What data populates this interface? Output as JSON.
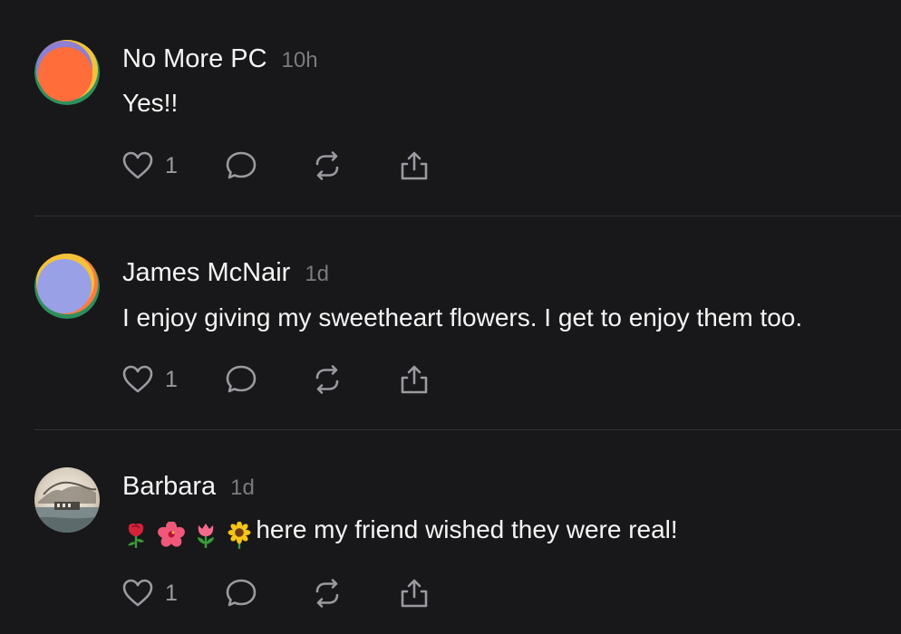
{
  "posts": [
    {
      "author": "No More PC",
      "time": "10h",
      "text": "Yes!!",
      "likes": "1",
      "avatar_icon": "orange-abstract-avatar"
    },
    {
      "author": "James McNair",
      "time": "1d",
      "text": "I enjoy giving my sweetheart flowers. I get to enjoy them too.",
      "likes": "1",
      "avatar_icon": "lavender-abstract-avatar"
    },
    {
      "author": "Barbara",
      "time": "1d",
      "text": "here my friend wished they were real!",
      "emojis": [
        "rose",
        "hibiscus",
        "tulip",
        "sunflower"
      ],
      "likes": "1",
      "avatar_icon": "photo-avatar-tree"
    }
  ],
  "icons": {
    "like": "heart-icon",
    "reply": "comment-bubble-icon",
    "repost": "repost-arrows-icon",
    "share": "share-upload-icon"
  },
  "colors": {
    "background": "#18181a",
    "primary_text": "#f5f5f5",
    "secondary_text": "#7b7b80",
    "icon": "#9a9aa0",
    "divider": "#323235"
  }
}
